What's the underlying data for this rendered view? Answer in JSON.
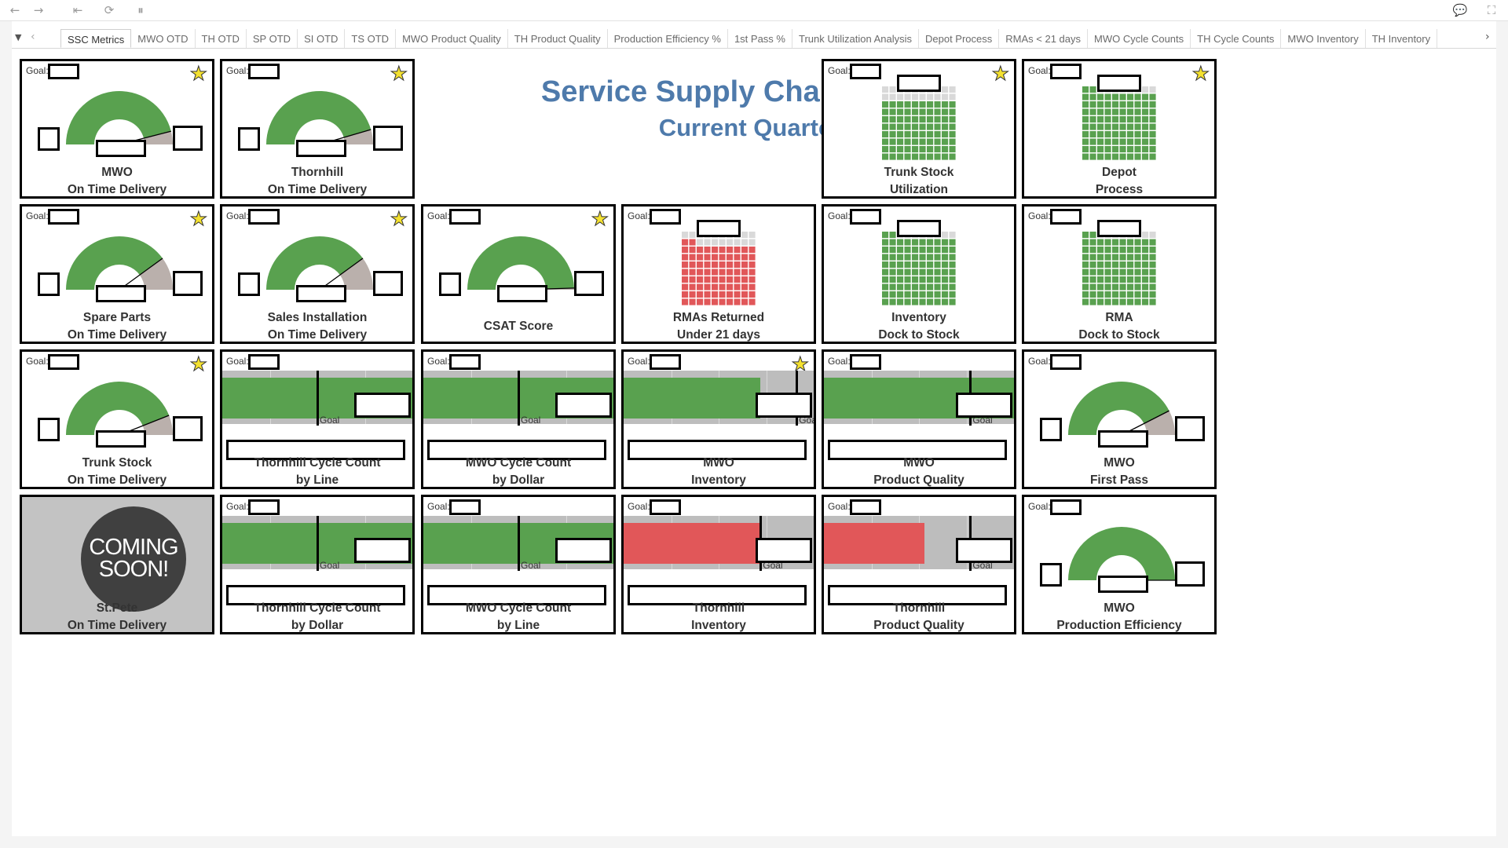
{
  "toolbar": {
    "buttons": [
      {
        "name": "back-icon",
        "glyph": "←"
      },
      {
        "name": "forward-icon",
        "glyph": "→"
      },
      {
        "name": "revert-icon",
        "glyph": "⇤"
      },
      {
        "name": "refresh-icon",
        "glyph": "⟳"
      },
      {
        "name": "pause-icon",
        "glyph": "⏸"
      },
      {
        "name": "comment-icon",
        "glyph": "💬"
      },
      {
        "name": "fullscreen-icon",
        "glyph": "⛶"
      }
    ]
  },
  "tabs": {
    "dropdown_glyph": "▼",
    "prev_glyph": "‹",
    "next_glyph": "›",
    "items": [
      "SSC Metrics",
      "MWO OTD",
      "TH OTD",
      "SP OTD",
      "SI OTD",
      "TS OTD",
      "MWO Product Quality",
      "TH Product Quality",
      "Production Efficiency %",
      "1st Pass %",
      "Trunk Utilization Analysis",
      "Depot Process",
      "RMAs < 21 days",
      "MWO Cycle Counts",
      "TH Cycle Counts",
      "MWO Inventory",
      "TH Inventory"
    ],
    "active_index": 0
  },
  "dashboard": {
    "title": "Service Supply Chain Metrics",
    "subtitle": "Current Quarter"
  },
  "colors": {
    "good": "#59a14f",
    "bad": "#e15759",
    "neutral": "#bab0ac",
    "empty": "#d9d9d9",
    "band": "#bdbdbd",
    "band_dark": "#a8a8a8",
    "title": "#4e7aab",
    "star": "#f4e130"
  },
  "goal_label": "Goal:",
  "goal_tick_label": "Goal",
  "tiles": [
    {
      "id": "mwo-otd",
      "type": "gauge",
      "label": [
        "MWO",
        "On Time Delivery"
      ],
      "star": true,
      "fraction": 0.92,
      "star_glyph": "★"
    },
    {
      "id": "th-otd",
      "type": "gauge",
      "label": [
        "Thornhill",
        "On Time Delivery"
      ],
      "star": true,
      "fraction": 0.91,
      "star_glyph": "★"
    },
    {
      "id": "trunk-stock-util",
      "type": "waffle",
      "label": [
        "Trunk Stock",
        "Utilization"
      ],
      "star": true,
      "fraction": 0.8,
      "color": "good",
      "star_glyph": "★"
    },
    {
      "id": "depot-process",
      "type": "waffle",
      "label": [
        "Depot",
        "Process"
      ],
      "star": true,
      "fraction": 0.92,
      "color": "good",
      "star_glyph": "★"
    },
    {
      "id": "spare-parts-otd",
      "type": "gauge",
      "label": [
        "Spare Parts",
        "On Time Delivery"
      ],
      "star": true,
      "fraction": 0.8,
      "star_glyph": "★"
    },
    {
      "id": "sales-install-otd",
      "type": "gauge",
      "label": [
        "Sales Installation",
        "On Time Delivery"
      ],
      "star": true,
      "fraction": 0.8,
      "star_glyph": "★"
    },
    {
      "id": "csat-score",
      "type": "gauge",
      "label": [
        "CSAT Score"
      ],
      "star": true,
      "fraction": 0.99,
      "star_glyph": "★"
    },
    {
      "id": "rmas-returned",
      "type": "waffle",
      "label": [
        "RMAs Returned",
        "Under 21 days"
      ],
      "star": false,
      "fraction": 0.82,
      "color": "bad"
    },
    {
      "id": "inventory-dock",
      "type": "waffle",
      "label": [
        "Inventory",
        "Dock to Stock"
      ],
      "star": false,
      "fraction": 0.92,
      "color": "good"
    },
    {
      "id": "rma-dock",
      "type": "waffle",
      "label": [
        "RMA",
        "Dock to Stock"
      ],
      "star": false,
      "fraction": 0.92,
      "color": "good"
    },
    {
      "id": "trunk-stock-otd",
      "type": "gauge",
      "label": [
        "Trunk Stock",
        "On Time Delivery"
      ],
      "star": true,
      "fraction": 0.88,
      "star_glyph": "★"
    },
    {
      "id": "th-cycle-count-line",
      "type": "bullet",
      "label": [
        "Thornhill Cycle Count",
        "by Line"
      ],
      "star": false,
      "fraction": 1.0,
      "goal": 0.5,
      "color": "good"
    },
    {
      "id": "mwo-cycle-count-dollar",
      "type": "bullet",
      "label": [
        "MWO Cycle Count",
        "by Dollar"
      ],
      "star": false,
      "fraction": 1.0,
      "goal": 0.5,
      "color": "good"
    },
    {
      "id": "mwo-inventory",
      "type": "bullet",
      "label": [
        "MWO",
        "Inventory"
      ],
      "star": true,
      "fraction": 0.72,
      "goal": 0.91,
      "color": "good",
      "star_glyph": "★"
    },
    {
      "id": "mwo-product-quality",
      "type": "bullet",
      "label": [
        "MWO",
        "Product Quality"
      ],
      "star": false,
      "fraction": 1.0,
      "goal": 0.77,
      "color": "good"
    },
    {
      "id": "mwo-first-pass",
      "type": "gauge",
      "label": [
        "MWO",
        "First Pass"
      ],
      "star": false,
      "fraction": 0.85
    },
    {
      "id": "stpete-otd",
      "type": "coming",
      "label": [
        "St.Pete",
        "On Time Delivery"
      ],
      "coming": [
        "COMING",
        "SOON!"
      ]
    },
    {
      "id": "th-cycle-count-dollar",
      "type": "bullet",
      "label": [
        "Thornhill Cycle Count",
        "by Dollar"
      ],
      "star": false,
      "fraction": 1.0,
      "goal": 0.5,
      "color": "good"
    },
    {
      "id": "mwo-cycle-count-line",
      "type": "bullet",
      "label": [
        "MWO Cycle Count",
        "by Line"
      ],
      "star": false,
      "fraction": 1.0,
      "goal": 0.5,
      "color": "good"
    },
    {
      "id": "th-inventory",
      "type": "bullet",
      "label": [
        "Thornhill",
        "Inventory"
      ],
      "star": false,
      "fraction": 0.72,
      "goal": 0.72,
      "color": "bad"
    },
    {
      "id": "th-product-quality",
      "type": "bullet",
      "label": [
        "Thornhill",
        "Product Quality"
      ],
      "star": false,
      "fraction": 0.53,
      "goal": 0.77,
      "color": "bad"
    },
    {
      "id": "mwo-prod-efficiency",
      "type": "gauge",
      "label": [
        "MWO",
        "Production Efficiency"
      ],
      "star": false,
      "fraction": 1.0
    }
  ]
}
